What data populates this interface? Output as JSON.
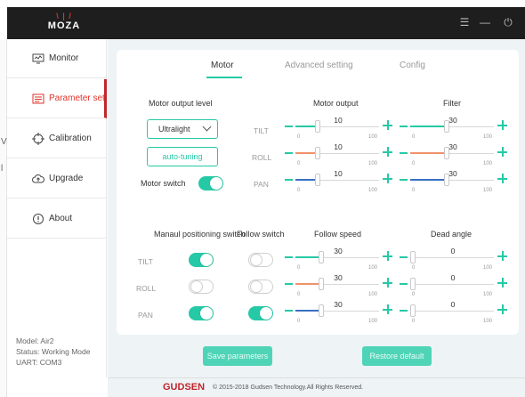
{
  "app": {
    "logo_text": "MOZA",
    "logo_rays": "\\ | /"
  },
  "window_controls": {
    "menu": "☰",
    "minimize": "—",
    "power": "⏻"
  },
  "left_edge": {
    "letter_1": "V",
    "letter_2": "l"
  },
  "sidebar": {
    "items": [
      {
        "label": "Monitor",
        "icon": "monitor-icon",
        "active": false
      },
      {
        "label": "Parameter set",
        "icon": "parameter-icon",
        "active": true
      },
      {
        "label": "Calibration",
        "icon": "crosshair-icon",
        "active": false
      },
      {
        "label": "Upgrade",
        "icon": "cloud-upload-icon",
        "active": false
      },
      {
        "label": "About",
        "icon": "info-icon",
        "active": false
      }
    ],
    "model": "Model: Air2",
    "status": "Status: Working Mode",
    "uart": "UART: COM3"
  },
  "tabs": [
    {
      "label": "Motor",
      "active": true
    },
    {
      "label": "Advanced setting",
      "active": false
    },
    {
      "label": "Config",
      "active": false
    }
  ],
  "motor": {
    "output_level_label": "Motor output level",
    "output_level_value": "Ultralight",
    "auto_tuning_label": "auto-tuning",
    "motor_switch_label": "Motor switch",
    "motor_switch_on": true,
    "motor_output_header": "Motor output",
    "filter_header": "Filter",
    "axes": [
      {
        "name": "TILT",
        "output": "10",
        "filter": "30",
        "color": "#26c9a6"
      },
      {
        "name": "ROLL",
        "output": "10",
        "filter": "30",
        "color": "#f0926a"
      },
      {
        "name": "PAN",
        "output": "10",
        "filter": "30",
        "color": "#3a6fc4"
      }
    ]
  },
  "follow": {
    "manual_header": "Manaul positioning switch",
    "follow_switch_header": "Follow switch",
    "follow_speed_header": "Follow speed",
    "dead_angle_header": "Dead angle",
    "axes": [
      {
        "name": "TILT",
        "manual_on": true,
        "follow_on": false,
        "speed": "30",
        "dead": "0",
        "color": "#26c9a6"
      },
      {
        "name": "ROLL",
        "manual_on": false,
        "follow_on": false,
        "speed": "30",
        "dead": "0",
        "color": "#f0926a"
      },
      {
        "name": "PAN",
        "manual_on": true,
        "follow_on": true,
        "speed": "30",
        "dead": "0",
        "color": "#3a6fc4"
      }
    ]
  },
  "slider_range": {
    "min": "0",
    "max": "100"
  },
  "actions": {
    "save": "Save parameters",
    "restore": "Restore default"
  },
  "footer": {
    "brand": "GUDSEN",
    "copyright": "© 2015-2018 Gudsen Technology.All Rights Reserved."
  }
}
